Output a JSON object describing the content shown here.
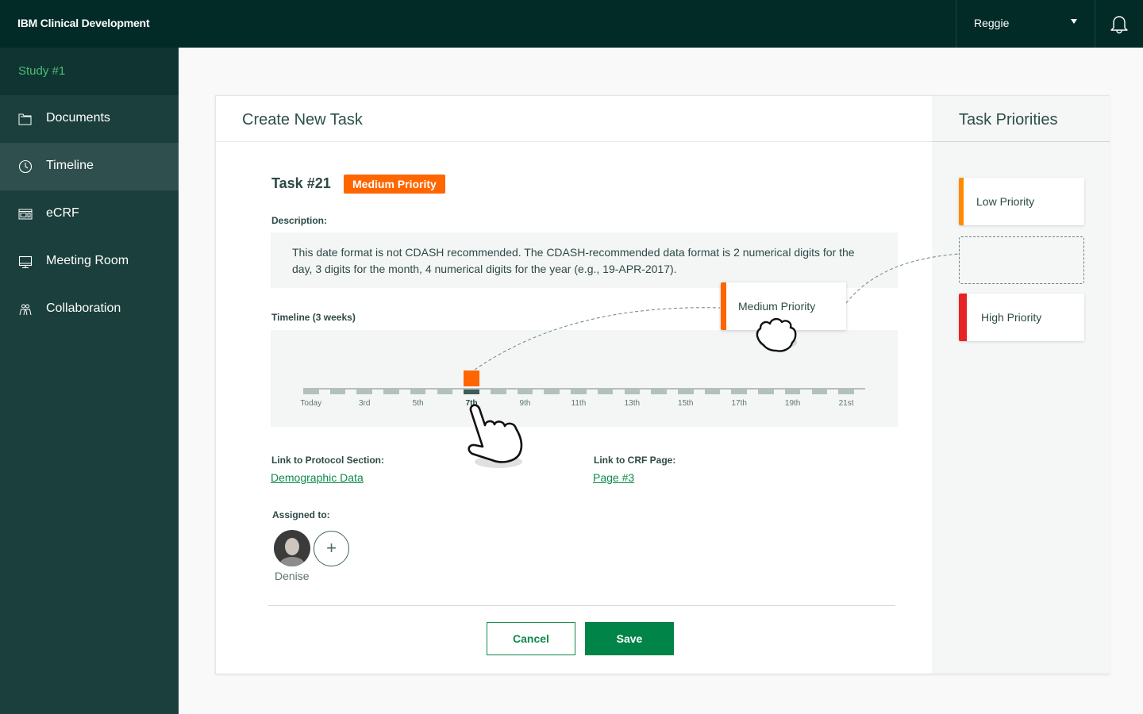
{
  "app": {
    "title": "IBM Clinical Development",
    "user": "Reggie"
  },
  "sidebar": {
    "study": "Study #1",
    "items": [
      {
        "label": "Documents",
        "icon": "folder-icon",
        "active": false
      },
      {
        "label": "Timeline",
        "icon": "clock-icon",
        "active": true
      },
      {
        "label": "eCRF",
        "icon": "form-icon",
        "active": false
      },
      {
        "label": "Meeting Room",
        "icon": "monitor-icon",
        "active": false
      },
      {
        "label": "Collaboration",
        "icon": "people-icon",
        "active": false
      }
    ]
  },
  "form": {
    "title": "Create New Task",
    "task_title": "Task #21",
    "priority_badge": "Medium Priority",
    "description_label": "Description:",
    "description": "This date format is not CDASH recommended. The CDASH-recommended data format is 2 numerical digits for the day, 3 digits for the month, 4 numerical digits for the year (e.g., 19-APR-2017).",
    "timeline_label": "Timeline (3 weeks)",
    "timeline": {
      "days": 21,
      "selected_day": 7,
      "labels": [
        "Today",
        "3rd",
        "5th",
        "7th",
        "9th",
        "11th",
        "13th",
        "15th",
        "17th",
        "19th",
        "21st"
      ],
      "label_days": [
        1,
        3,
        5,
        7,
        9,
        11,
        13,
        15,
        17,
        19,
        21
      ]
    },
    "protocol_label": "Link to Protocol Section:",
    "protocol_link": "Demographic Data",
    "crf_label": "Link to CRF Page:",
    "crf_link": "Page #3",
    "assigned_label": "Assigned to:",
    "assignee": "Denise",
    "add_assignee": "+",
    "cancel": "Cancel",
    "save": "Save"
  },
  "priorities": {
    "title": "Task Priorities",
    "items": [
      {
        "label": "Low Priority",
        "color": "#ff8a00"
      },
      {
        "label": "Medium Priority",
        "color": "#ff6600",
        "dragging": true
      },
      {
        "label": "High Priority",
        "color": "#e62325"
      }
    ]
  },
  "colors": {
    "topbar": "#022b28",
    "sidebar": "#1b3f3c",
    "accent_green": "#008448",
    "medium_priority": "#ff6600"
  }
}
